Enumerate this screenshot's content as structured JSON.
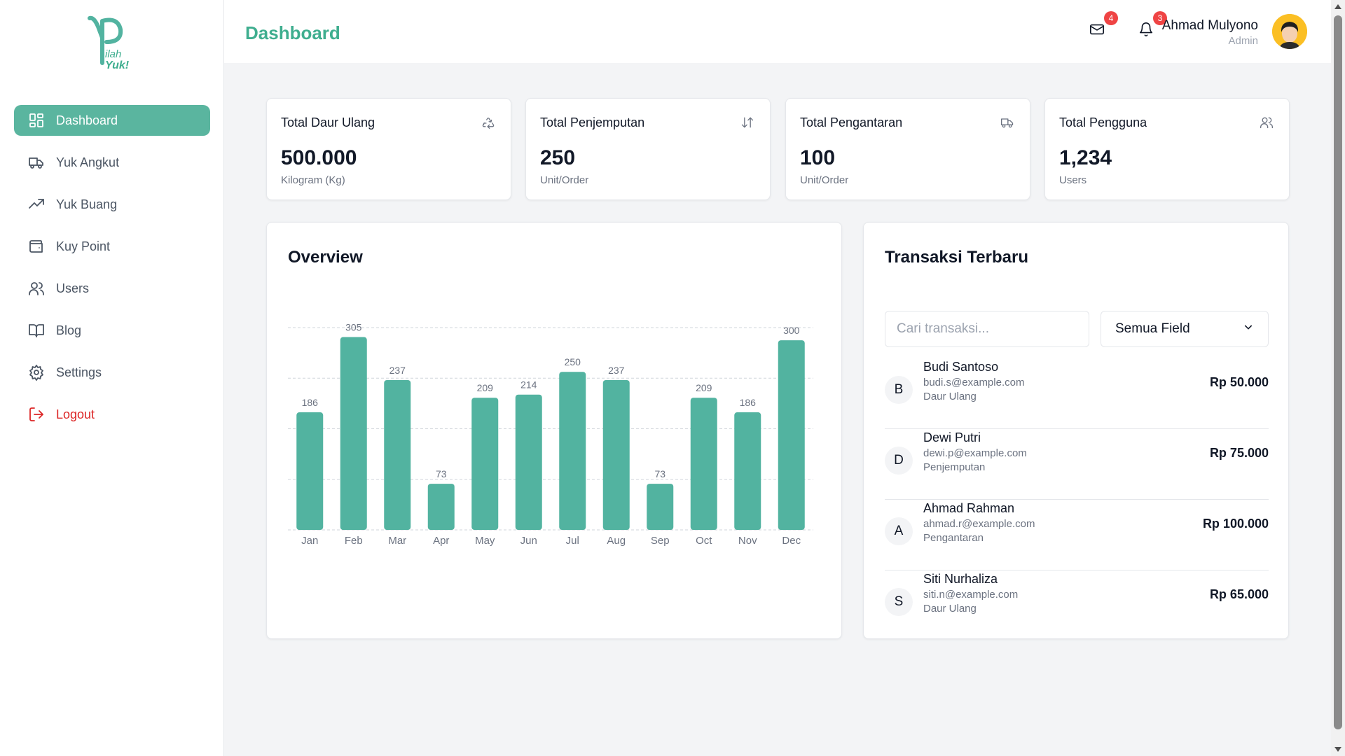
{
  "brand": {
    "logo_text": "PilahYuk!",
    "accent_color": "#5ab59f",
    "title_color": "#3fae8f"
  },
  "sidebar": {
    "items": [
      {
        "label": "Dashboard",
        "icon": "dashboard-grid-icon",
        "active": true
      },
      {
        "label": "Yuk Angkut",
        "icon": "truck-icon"
      },
      {
        "label": "Yuk Buang",
        "icon": "trending-up-icon"
      },
      {
        "label": "Kuy Point",
        "icon": "wallet-icon"
      },
      {
        "label": "Users",
        "icon": "users-icon"
      },
      {
        "label": "Blog",
        "icon": "book-open-icon"
      },
      {
        "label": "Settings",
        "icon": "gear-icon"
      },
      {
        "label": "Logout",
        "icon": "logout-icon",
        "color": "#dc2626"
      }
    ]
  },
  "header": {
    "title": "Dashboard",
    "mail_count": "4",
    "notification_count": "3",
    "user_name": "Ahmad Mulyono",
    "user_role": "Admin"
  },
  "stats": [
    {
      "title": "Total Daur Ulang",
      "value": "500.000",
      "unit": "Kilogram (Kg)",
      "icon": "recycle-icon"
    },
    {
      "title": "Total Penjemputan",
      "value": "250",
      "unit": "Unit/Order",
      "icon": "arrows-up-down-icon"
    },
    {
      "title": "Total Pengantaran",
      "value": "100",
      "unit": "Unit/Order",
      "icon": "truck-icon"
    },
    {
      "title": "Total Pengguna",
      "value": "1,234",
      "unit": "Users",
      "icon": "users-icon"
    }
  ],
  "overview": {
    "title": "Overview"
  },
  "chart_data": {
    "type": "bar",
    "categories": [
      "Jan",
      "Feb",
      "Mar",
      "Apr",
      "May",
      "Jun",
      "Jul",
      "Aug",
      "Sep",
      "Oct",
      "Nov",
      "Dec"
    ],
    "values": [
      186,
      305,
      237,
      73,
      209,
      214,
      250,
      237,
      73,
      209,
      186,
      300
    ],
    "ylim": [
      0,
      320
    ],
    "grid": true,
    "bar_color": "#52b3a0",
    "data_labels": true
  },
  "transactions": {
    "title": "Transaksi Terbaru",
    "search_placeholder": "Cari transaksi...",
    "filter_selected": "Semua Field",
    "items": [
      {
        "initial": "B",
        "name": "Budi Santoso",
        "email": "budi.s@example.com",
        "type": "Daur Ulang",
        "amount": "Rp 50.000"
      },
      {
        "initial": "D",
        "name": "Dewi Putri",
        "email": "dewi.p@example.com",
        "type": "Penjemputan",
        "amount": "Rp 75.000"
      },
      {
        "initial": "A",
        "name": "Ahmad Rahman",
        "email": "ahmad.r@example.com",
        "type": "Pengantaran",
        "amount": "Rp 100.000"
      },
      {
        "initial": "S",
        "name": "Siti Nurhaliza",
        "email": "siti.n@example.com",
        "type": "Daur Ulang",
        "amount": "Rp 65.000"
      }
    ]
  }
}
